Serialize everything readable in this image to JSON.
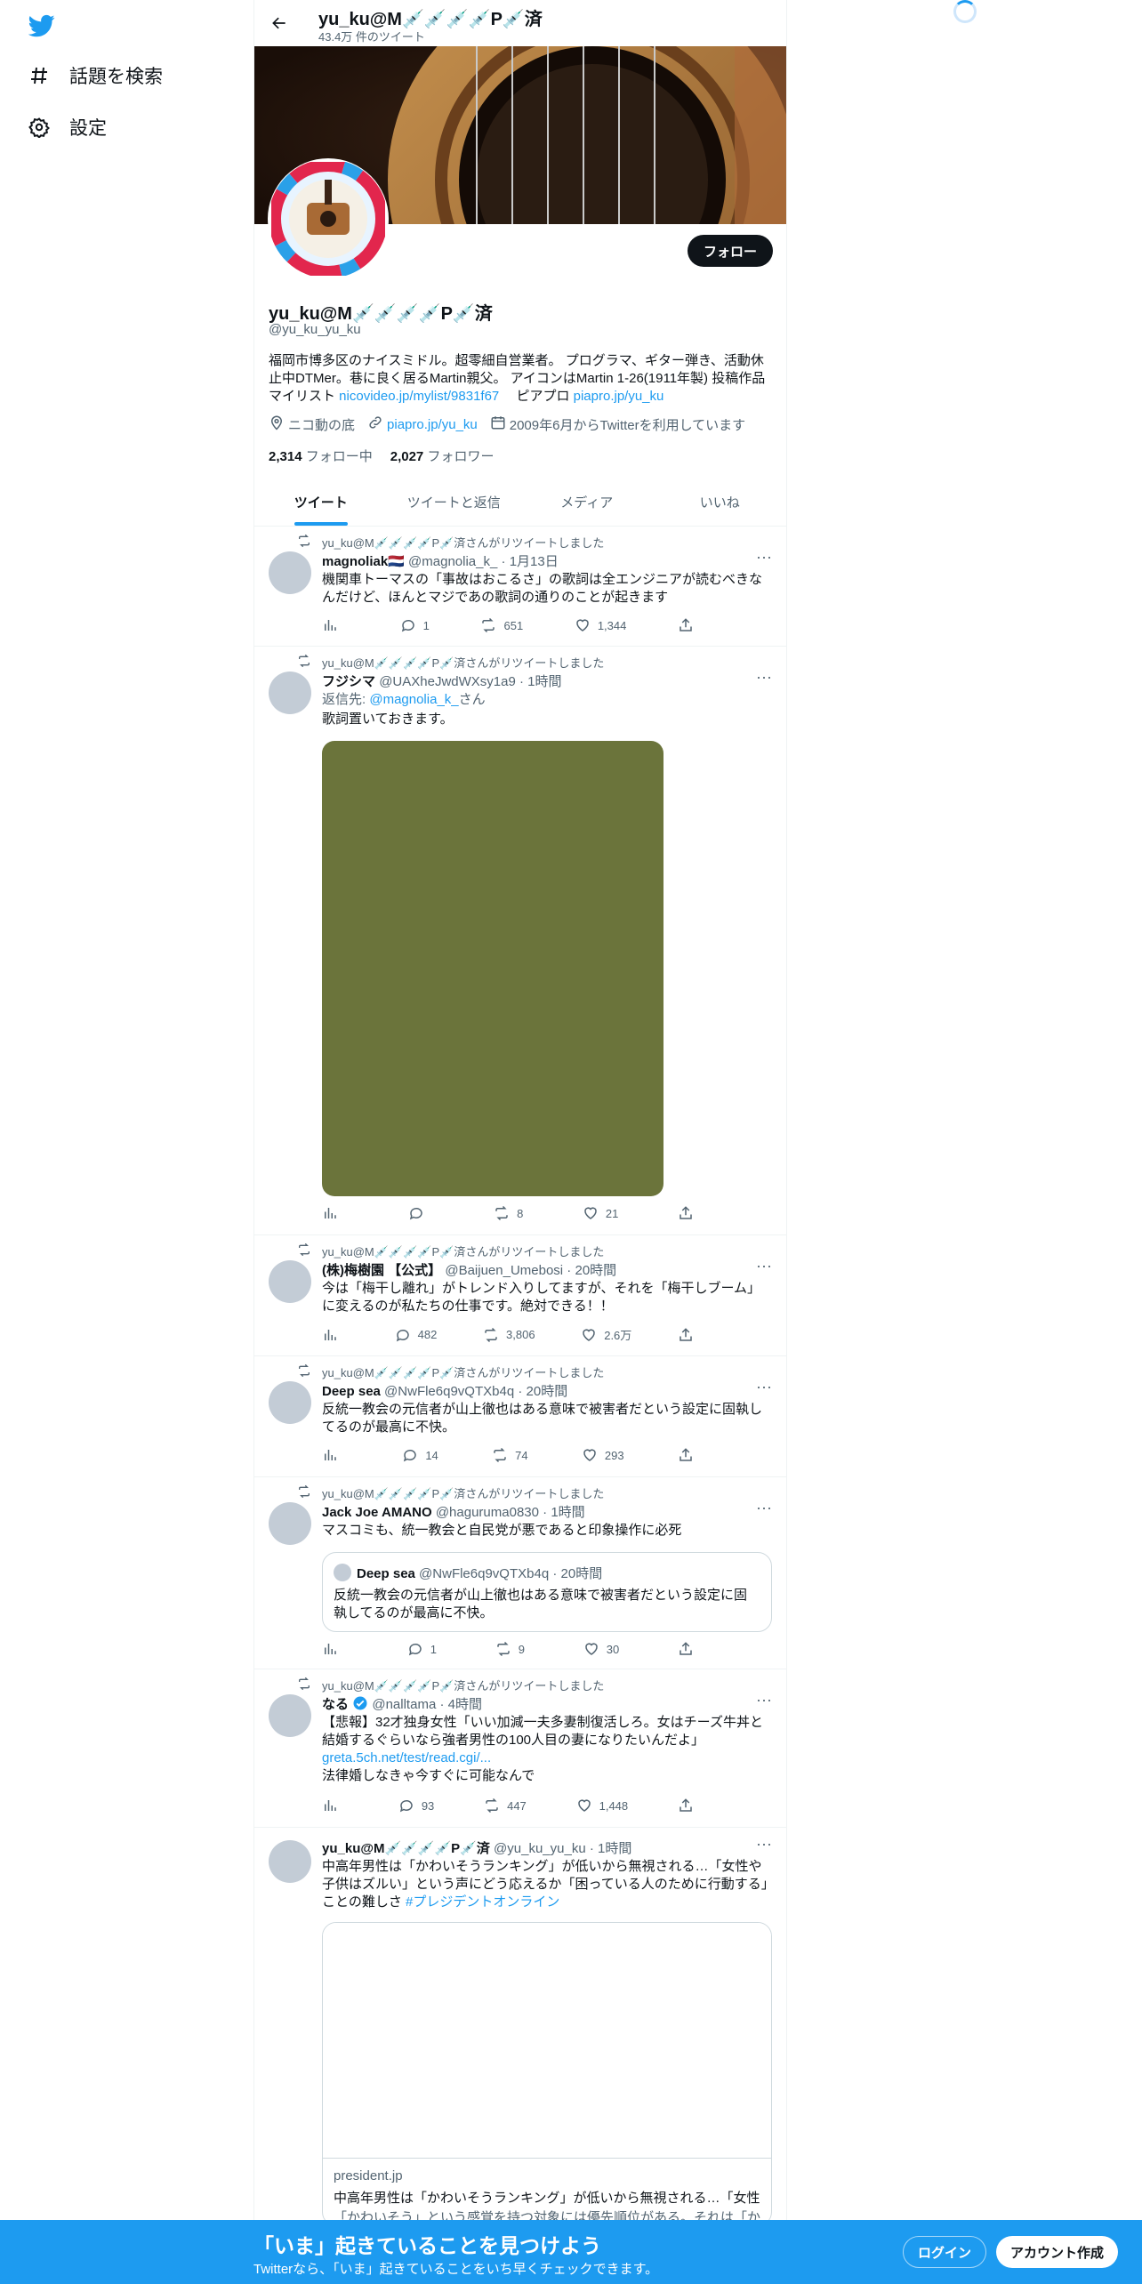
{
  "nav": {
    "explore_label": "話題を検索",
    "settings_label": "設定"
  },
  "header": {
    "name": "yu_ku@M💉💉💉💉P💉済",
    "tweet_count": "43.4万 件のツイート"
  },
  "profile": {
    "name": "yu_ku@M💉💉💉💉P💉済",
    "handle": "@yu_ku_yu_ku",
    "follow_label": "フォロー",
    "bio_text": "福岡市博多区のナイスミドル。超零細自営業者。 プログラマ、ギター弾き、活動休止中DTMer。巷に良く居るMartin親父。 アイコンはMartin 1-26(1911年製)  投稿作品マイリスト ",
    "bio_link1": "nicovideo.jp/mylist/9831f67",
    "bio_mid": "　 ピアプロ ",
    "bio_link2": "piapro.jp/yu_ku",
    "location": "ニコ動の底",
    "website": "piapro.jp/yu_ku",
    "joined": "2009年6月からTwitterを利用しています",
    "following_count": "2,314",
    "following_label": "フォロー中",
    "followers_count": "2,027",
    "followers_label": "フォロワー"
  },
  "tabs": [
    "ツイート",
    "ツイートと返信",
    "メディア",
    "いいね"
  ],
  "retweet_label": "yu_ku@M💉💉💉💉P💉済さんがリツイートしました",
  "tweets": [
    {
      "name": "magnoliak🇳🇱",
      "handle": "@magnolia_k_",
      "time": "1月13日",
      "text": "機関車トーマスの「事故はおこるさ」の歌詞は全エンジニアが読むべきなんだけど、ほんとマジであの歌詞の通りのことが起きます",
      "replies": "1",
      "retweets": "651",
      "likes": "1,344"
    },
    {
      "name": "フジシマ",
      "handle": "@UAXheJwdWXsy1a9",
      "time": "1時間",
      "reply_prefix": "返信先: ",
      "reply_to": "@magnolia_k_",
      "reply_suffix": "さん",
      "text": "歌詞置いておきます。",
      "replies": "",
      "retweets": "8",
      "likes": "21",
      "image_color": "#6b743b"
    },
    {
      "name": "(株)梅樹園 【公式】",
      "handle": "@Baijuen_Umebosi",
      "time": "20時間",
      "text": "今は「梅干し離れ」がトレンド入りしてますが、それを「梅干しブーム」に変えるのが私たちの仕事です。絶対できる！！",
      "replies": "482",
      "retweets": "3,806",
      "likes": "2.6万"
    },
    {
      "name": "Deep sea",
      "handle": "@NwFle6q9vQTXb4q",
      "time": "20時間",
      "text": "反統一教会の元信者が山上徹也はある意味で被害者だという設定に固執してるのが最高に不快。",
      "replies": "14",
      "retweets": "74",
      "likes": "293"
    },
    {
      "name": "Jack Joe AMANO",
      "handle": "@haguruma0830",
      "time": "1時間",
      "text": "マスコミも、統一教会と自民党が悪であると印象操作に必死",
      "quote_name": "Deep sea",
      "quote_handle": "@NwFle6q9vQTXb4q",
      "quote_time": "20時間",
      "quote_text": "反統一教会の元信者が山上徹也はある意味で被害者だという設定に固執してるのが最高に不快。",
      "replies": "1",
      "retweets": "9",
      "likes": "30"
    },
    {
      "name": "なる",
      "handle": "@nalltama",
      "time": "4時間",
      "text": "【悲報】32才独身女性「いい加減一夫多妻制復活しろ。女はチーズ牛丼と結婚するぐらいなら強者男性の100人目の妻になりたいんだよ」",
      "link": "greta.5ch.net/test/read.cgi/...",
      "text2": "法律婚しなきゃ今すぐに可能なんで",
      "replies": "93",
      "retweets": "447",
      "likes": "1,448"
    },
    {
      "name": "yu_ku@M💉💉💉💉P💉済",
      "handle": "@yu_ku_yu_ku",
      "time": "1時間",
      "text": "中高年男性は「かわいそうランキング」が低いから無視される…「女性や子供はズルい」という声にどう応えるか「困っている人のために行動する」ことの難しさ ",
      "hashtag": "#プレジデントオンライン",
      "card_domain": "president.jp",
      "card_title": "中高年男性は「かわいそうランキング」が低いから無視される…「女性...",
      "card_desc": "「かわいそう」という感覚を持つ対象には優先順位がある。それは「か"
    }
  ],
  "bottom": {
    "title": "「いま」起きていることを見つけよう",
    "subtitle": "Twitterなら、「いま」起きていることをいち早くチェックできます。",
    "login_label": "ログイン",
    "signup_label": "アカウント作成"
  },
  "colors": {
    "accent": "#1d9bf0",
    "text": "#0f1419",
    "muted": "#536471"
  }
}
